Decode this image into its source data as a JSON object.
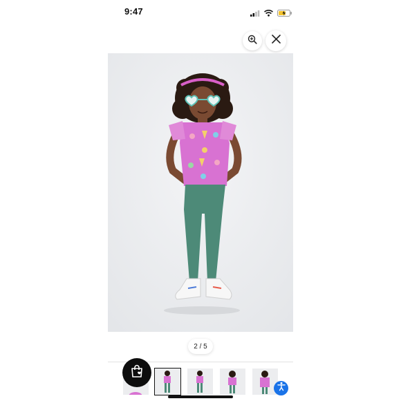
{
  "status_bar": {
    "time": "9:47",
    "icons": [
      "cellular-signal-icon",
      "wifi-icon",
      "battery-charging-icon"
    ],
    "battery_color": "#f4c430"
  },
  "controls": {
    "zoom_icon": "zoom-in-icon",
    "close_icon": "close-icon"
  },
  "gallery": {
    "page_indicator": "2 / 5",
    "current_index": 2,
    "total": 5,
    "thumbnails": [
      {
        "name": "thumbnail-1",
        "selected": false
      },
      {
        "name": "thumbnail-2",
        "selected": true
      },
      {
        "name": "thumbnail-3",
        "selected": false
      },
      {
        "name": "thumbnail-4",
        "selected": false
      },
      {
        "name": "thumbnail-5",
        "selected": false
      }
    ]
  },
  "floating": {
    "bag_icon": "shopping-bag-heart-icon",
    "accessibility_icon": "accessibility-icon",
    "accessibility_color": "#1a73e8"
  },
  "colors": {
    "shirt": "#d872d2",
    "leggings": "#4d8a78",
    "background": "#ecedef"
  }
}
